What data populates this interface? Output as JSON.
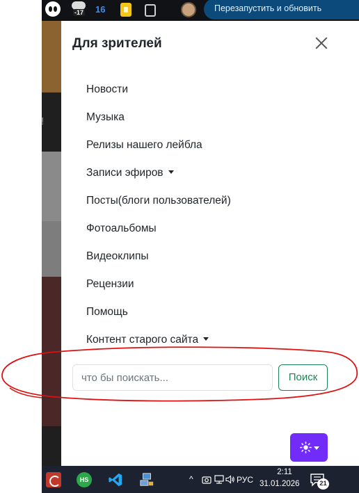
{
  "browser": {
    "restart_button": "Перезапустить и обновить",
    "menu_glyph": "⋮",
    "badge_16": "16",
    "weather_temp": "-17"
  },
  "panel": {
    "title": "Для зрителей",
    "nav_items": [
      {
        "label": "Новости",
        "dropdown": false
      },
      {
        "label": "Музыка",
        "dropdown": false
      },
      {
        "label": "Релизы нашего лейбла",
        "dropdown": false
      },
      {
        "label": "Записи эфиров",
        "dropdown": true
      },
      {
        "label": "Посты(блоги пользователей)",
        "dropdown": false
      },
      {
        "label": "Фотоальбомы",
        "dropdown": false
      },
      {
        "label": "Видеоклипы",
        "dropdown": false
      },
      {
        "label": "Рецензии",
        "dropdown": false
      },
      {
        "label": "Помощь",
        "dropdown": false
      },
      {
        "label": "Контент старого сайта",
        "dropdown": true
      }
    ],
    "search": {
      "placeholder": "что бы поискать...",
      "button_label": "Поиск"
    },
    "theme_toggle_icon": "sun-icon"
  },
  "background": {
    "exclamation": "!"
  },
  "taskbar": {
    "hs_label": "HS",
    "chevron": "^",
    "language": "РУС",
    "time": "2:11",
    "date": "31.01.2026",
    "notification_count": "21"
  },
  "colors": {
    "search_button": "#198754",
    "theme_button": "#712cf9",
    "annotation": "#e01010",
    "taskbar": "#1c2230",
    "restart_button": "#0b4a7a"
  }
}
